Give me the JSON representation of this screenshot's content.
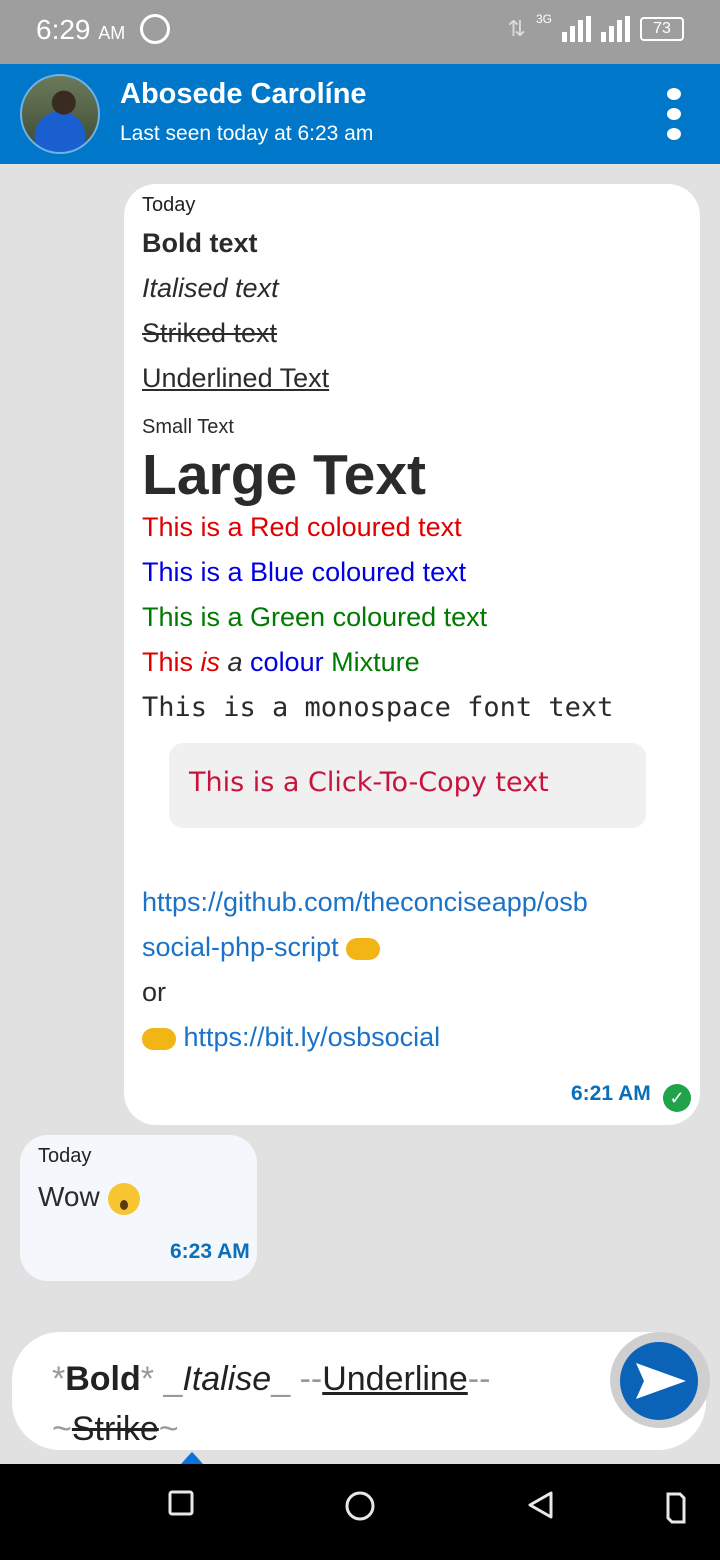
{
  "status_bar": {
    "time": "6:29",
    "ampm": "AM",
    "network": "3G",
    "battery": "73"
  },
  "header": {
    "contact_name": "Abosede Carolíne",
    "last_seen": "Last seen today at 6:23 am"
  },
  "outgoing": {
    "date_label": "Today",
    "lines": {
      "bold": "Bold text",
      "italic": "Italised text",
      "strike": "Striked text",
      "underline": "Underlined Text",
      "small": "Small Text",
      "large": "Large Text",
      "red": "This is a Red coloured text",
      "blue": "This is a Blue coloured text",
      "green": "This is a Green coloured text",
      "mix_1": "This ",
      "mix_2": "is",
      "mix_3": " a ",
      "mix_4": "colour",
      "mix_5": " Mixture",
      "mono": "This is a monospace font text",
      "copy": "This is a Click-To-Copy text",
      "link1_a": "https://github.com/theconciseapp/osb",
      "link1_b": "social-php-script",
      "or": "or",
      "link2": "https://bit.ly/osbsocial"
    },
    "time": "6:21 AM",
    "status_icon": "delivered-check-icon"
  },
  "incoming": {
    "date_label": "Today",
    "message": "Wow",
    "emoji": "astonished-face",
    "time": "6:23 AM"
  },
  "composer": {
    "p1": "*",
    "p2": "Bold",
    "p3": "*",
    "p4": " _",
    "p5": "Italise",
    "p6": "_ ",
    "p7": "--",
    "p8": "Underline",
    "p9": "--",
    "p10": "~",
    "p11": "Strike",
    "p12": "~"
  },
  "colors": {
    "header": "#0077c8",
    "accent": "#0b63b8",
    "red": "#e00000",
    "blue": "#0000e0",
    "green": "#007a00",
    "link": "#1a73c8"
  }
}
